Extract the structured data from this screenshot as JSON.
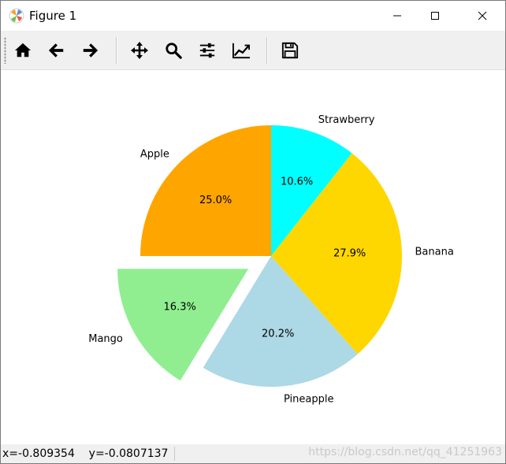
{
  "window": {
    "title": "Figure 1",
    "icon": "matplotlib-icon",
    "controls": [
      "minimize-icon",
      "maximize-icon",
      "close-icon"
    ]
  },
  "toolbar": {
    "buttons": [
      {
        "name": "home",
        "icon": "home-icon"
      },
      {
        "name": "back",
        "icon": "arrow-left-icon"
      },
      {
        "name": "forward",
        "icon": "arrow-right-icon"
      },
      {
        "name": "pan",
        "icon": "move-icon"
      },
      {
        "name": "zoom",
        "icon": "search-icon"
      },
      {
        "name": "subplots",
        "icon": "sliders-icon"
      },
      {
        "name": "edit-axis",
        "icon": "line-chart-icon"
      },
      {
        "name": "save",
        "icon": "floppy-disk-icon"
      }
    ]
  },
  "chart_data": {
    "type": "pie",
    "startangle": 90,
    "direction": "clockwise",
    "slices": [
      {
        "label": "Strawberry",
        "pct_label": "10.6%",
        "value": 10.6,
        "color": "#00ffff",
        "explode": 0
      },
      {
        "label": "Banana",
        "pct_label": "27.9%",
        "value": 27.9,
        "color": "#ffd700",
        "explode": 0
      },
      {
        "label": "Pineapple",
        "pct_label": "20.2%",
        "value": 20.2,
        "color": "#add8e6",
        "explode": 0
      },
      {
        "label": "Mango",
        "pct_label": "16.3%",
        "value": 16.3,
        "color": "#90ee90",
        "explode": 0.2
      },
      {
        "label": "Apple",
        "pct_label": "25.0%",
        "value": 25.0,
        "color": "#ffa500",
        "explode": 0
      }
    ]
  },
  "status": {
    "coords": "x=-0.809354    y=-0.0807137",
    "watermark": "https://blog.csdn.net/qq_41251963"
  }
}
